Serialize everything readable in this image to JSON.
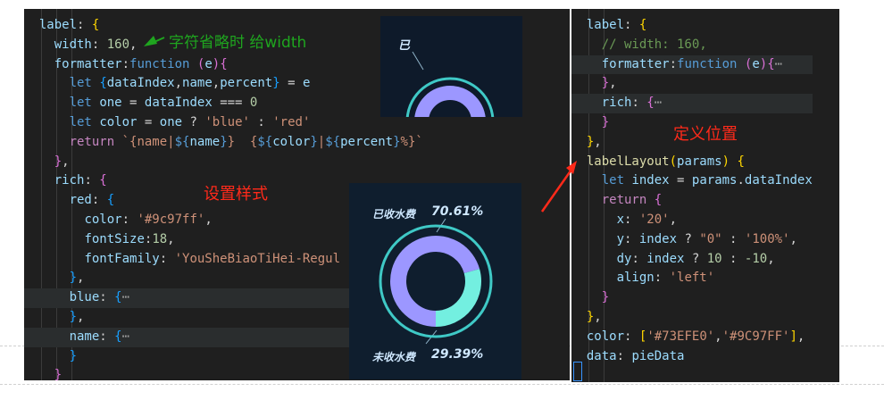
{
  "left_code": [
    {
      "hl": false,
      "t": [
        [
          "d",
          "  "
        ],
        [
          "v",
          "label"
        ],
        [
          "d",
          ": "
        ],
        [
          "y",
          "{"
        ]
      ]
    },
    {
      "hl": false,
      "t": [
        [
          "d",
          "    "
        ],
        [
          "v",
          "width"
        ],
        [
          "d",
          ": "
        ],
        [
          "n",
          "160"
        ],
        [
          "d",
          ","
        ]
      ]
    },
    {
      "hl": false,
      "t": [
        [
          "d",
          "    "
        ],
        [
          "v",
          "formatter"
        ],
        [
          "d",
          ":"
        ],
        [
          "k",
          "function"
        ],
        [
          "d",
          " "
        ],
        [
          "m",
          "("
        ],
        [
          "v",
          "e"
        ],
        [
          "m",
          ")"
        ],
        [
          "m",
          "{"
        ]
      ]
    },
    {
      "hl": false,
      "t": [
        [
          "d",
          "      "
        ],
        [
          "k",
          "let"
        ],
        [
          "d",
          " "
        ],
        [
          "b",
          "{"
        ],
        [
          "v",
          "dataIndex"
        ],
        [
          "d",
          ","
        ],
        [
          "v",
          "name"
        ],
        [
          "d",
          ","
        ],
        [
          "v",
          "percent"
        ],
        [
          "b",
          "}"
        ],
        [
          "d",
          " = "
        ],
        [
          "v",
          "e"
        ]
      ]
    },
    {
      "hl": false,
      "t": [
        [
          "d",
          "      "
        ],
        [
          "k",
          "let"
        ],
        [
          "d",
          " "
        ],
        [
          "v",
          "one"
        ],
        [
          "d",
          " = "
        ],
        [
          "v",
          "dataIndex"
        ],
        [
          "d",
          " === "
        ],
        [
          "n",
          "0"
        ]
      ]
    },
    {
      "hl": false,
      "t": [
        [
          "d",
          "      "
        ],
        [
          "k",
          "let"
        ],
        [
          "d",
          " "
        ],
        [
          "v",
          "color"
        ],
        [
          "d",
          " = "
        ],
        [
          "v",
          "one"
        ],
        [
          "d",
          " ? "
        ],
        [
          "s",
          "'blue'"
        ],
        [
          "d",
          " : "
        ],
        [
          "s",
          "'red'"
        ]
      ]
    },
    {
      "hl": false,
      "t": [
        [
          "d",
          "      "
        ],
        [
          "kw",
          "return"
        ],
        [
          "d",
          " "
        ],
        [
          "s",
          "`{name|"
        ],
        [
          "k",
          "${"
        ],
        [
          "v",
          "name"
        ],
        [
          "k",
          "}"
        ],
        [
          "s",
          "}  {"
        ],
        [
          "k",
          "${"
        ],
        [
          "v",
          "color"
        ],
        [
          "k",
          "}"
        ],
        [
          "s",
          "|"
        ],
        [
          "k",
          "${"
        ],
        [
          "v",
          "percent"
        ],
        [
          "k",
          "}"
        ],
        [
          "s",
          "%}`"
        ]
      ]
    },
    {
      "hl": false,
      "t": [
        [
          "d",
          "    "
        ],
        [
          "m",
          "}"
        ],
        [
          "d",
          ","
        ]
      ]
    },
    {
      "hl": false,
      "t": [
        [
          "d",
          "    "
        ],
        [
          "v",
          "rich"
        ],
        [
          "d",
          ": "
        ],
        [
          "m",
          "{"
        ]
      ]
    },
    {
      "hl": false,
      "t": [
        [
          "d",
          "      "
        ],
        [
          "v",
          "red"
        ],
        [
          "d",
          ": "
        ],
        [
          "b",
          "{"
        ]
      ]
    },
    {
      "hl": false,
      "t": [
        [
          "d",
          "        "
        ],
        [
          "v",
          "color"
        ],
        [
          "d",
          ": "
        ],
        [
          "s",
          "'#9c97ff'"
        ],
        [
          "d",
          ","
        ]
      ]
    },
    {
      "hl": false,
      "t": [
        [
          "d",
          "        "
        ],
        [
          "v",
          "fontSize"
        ],
        [
          "d",
          ":"
        ],
        [
          "n",
          "18"
        ],
        [
          "d",
          ","
        ]
      ]
    },
    {
      "hl": false,
      "t": [
        [
          "d",
          "        "
        ],
        [
          "v",
          "fontFamily"
        ],
        [
          "d",
          ": "
        ],
        [
          "s",
          "'YouSheBiaoTiHei-Regul"
        ]
      ]
    },
    {
      "hl": false,
      "t": [
        [
          "d",
          "      "
        ],
        [
          "b",
          "}"
        ],
        [
          "d",
          ","
        ]
      ]
    },
    {
      "hl": true,
      "t": [
        [
          "d",
          "      "
        ],
        [
          "v",
          "blue"
        ],
        [
          "d",
          ": "
        ],
        [
          "b",
          "{"
        ],
        [
          "fold",
          "⋯"
        ]
      ]
    },
    {
      "hl": false,
      "t": [
        [
          "d",
          "      "
        ],
        [
          "b",
          "}"
        ],
        [
          "d",
          ","
        ]
      ]
    },
    {
      "hl": true,
      "t": [
        [
          "d",
          "      "
        ],
        [
          "v",
          "name"
        ],
        [
          "d",
          ": "
        ],
        [
          "b",
          "{"
        ],
        [
          "fold",
          "⋯"
        ]
      ]
    },
    {
      "hl": false,
      "t": [
        [
          "d",
          "      "
        ],
        [
          "b",
          "}"
        ]
      ]
    },
    {
      "hl": false,
      "t": [
        [
          "d",
          "    "
        ],
        [
          "m",
          "}"
        ]
      ]
    }
  ],
  "right_code": [
    {
      "hl": false,
      "t": [
        [
          "d",
          "  "
        ],
        [
          "v",
          "label"
        ],
        [
          "d",
          ": "
        ],
        [
          "y",
          "{"
        ]
      ]
    },
    {
      "hl": false,
      "t": [
        [
          "d",
          "    "
        ],
        [
          "c",
          "// width: 160,"
        ]
      ]
    },
    {
      "hl": true,
      "t": [
        [
          "d",
          "    "
        ],
        [
          "v",
          "formatter"
        ],
        [
          "d",
          ":"
        ],
        [
          "k",
          "function"
        ],
        [
          "d",
          " "
        ],
        [
          "m",
          "("
        ],
        [
          "v",
          "e"
        ],
        [
          "m",
          ")"
        ],
        [
          "m",
          "{"
        ],
        [
          "fold",
          "⋯"
        ]
      ]
    },
    {
      "hl": false,
      "t": [
        [
          "d",
          "    "
        ],
        [
          "m",
          "}"
        ],
        [
          "d",
          ","
        ]
      ]
    },
    {
      "hl": true,
      "t": [
        [
          "d",
          "    "
        ],
        [
          "v",
          "rich"
        ],
        [
          "d",
          ": "
        ],
        [
          "m",
          "{"
        ],
        [
          "fold",
          "⋯"
        ]
      ]
    },
    {
      "hl": false,
      "t": [
        [
          "d",
          "    "
        ],
        [
          "m",
          "}"
        ]
      ]
    },
    {
      "hl": false,
      "t": [
        [
          "d",
          "  "
        ],
        [
          "y",
          "}"
        ],
        [
          "d",
          ","
        ]
      ]
    },
    {
      "hl": false,
      "t": [
        [
          "d",
          "  "
        ],
        [
          "f",
          "labelLayout"
        ],
        [
          "y",
          "("
        ],
        [
          "v",
          "params"
        ],
        [
          "y",
          ")"
        ],
        [
          "d",
          " "
        ],
        [
          "y",
          "{"
        ]
      ]
    },
    {
      "hl": false,
      "t": [
        [
          "d",
          "    "
        ],
        [
          "k",
          "let"
        ],
        [
          "d",
          " "
        ],
        [
          "v",
          "index"
        ],
        [
          "d",
          " = "
        ],
        [
          "v",
          "params"
        ],
        [
          "d",
          "."
        ],
        [
          "v",
          "dataIndex"
        ]
      ]
    },
    {
      "hl": false,
      "t": [
        [
          "d",
          "    "
        ],
        [
          "kw",
          "return"
        ],
        [
          "d",
          " "
        ],
        [
          "m",
          "{"
        ]
      ]
    },
    {
      "hl": false,
      "t": [
        [
          "d",
          "      "
        ],
        [
          "v",
          "x"
        ],
        [
          "d",
          ": "
        ],
        [
          "s",
          "'20'"
        ],
        [
          "d",
          ","
        ]
      ]
    },
    {
      "hl": false,
      "t": [
        [
          "d",
          "      "
        ],
        [
          "v",
          "y"
        ],
        [
          "d",
          ": "
        ],
        [
          "v",
          "index"
        ],
        [
          "d",
          " ? "
        ],
        [
          "s",
          "\"0\""
        ],
        [
          "d",
          " : "
        ],
        [
          "s",
          "'100%'"
        ],
        [
          "d",
          ","
        ]
      ]
    },
    {
      "hl": false,
      "t": [
        [
          "d",
          "      "
        ],
        [
          "v",
          "dy"
        ],
        [
          "d",
          ": "
        ],
        [
          "v",
          "index"
        ],
        [
          "d",
          " ? "
        ],
        [
          "n",
          "10"
        ],
        [
          "d",
          " : "
        ],
        [
          "n",
          "-10"
        ],
        [
          "d",
          ","
        ]
      ]
    },
    {
      "hl": false,
      "t": [
        [
          "d",
          "      "
        ],
        [
          "v",
          "align"
        ],
        [
          "d",
          ": "
        ],
        [
          "s",
          "'left'"
        ]
      ]
    },
    {
      "hl": false,
      "t": [
        [
          "d",
          "    "
        ],
        [
          "m",
          "}"
        ]
      ]
    },
    {
      "hl": false,
      "t": [
        [
          "d",
          "  "
        ],
        [
          "y",
          "}"
        ],
        [
          "d",
          ","
        ]
      ]
    },
    {
      "hl": false,
      "t": [
        [
          "d",
          "  "
        ],
        [
          "v",
          "color"
        ],
        [
          "d",
          ": "
        ],
        [
          "y",
          "["
        ],
        [
          "s",
          "'#73EFE0'"
        ],
        [
          "d",
          ","
        ],
        [
          "s",
          "'#9C97FF'"
        ],
        [
          "y",
          "]"
        ],
        [
          "d",
          ","
        ]
      ]
    },
    {
      "hl": false,
      "t": [
        [
          "d",
          "  "
        ],
        [
          "v",
          "data"
        ],
        [
          "d",
          ": "
        ],
        [
          "v",
          "pieData"
        ]
      ]
    }
  ],
  "annotations": {
    "ellipsis_note": "字符省略时  给width",
    "style_note": "设置样式",
    "position_note": "定义位置"
  },
  "preview_top": {
    "label": "已"
  },
  "preview_bottom": {
    "collected_label": "已收水费",
    "collected_pct": "70.61%",
    "uncollected_label": "未收水费",
    "uncollected_pct": "29.39%"
  },
  "pie": {
    "collected": 70.61,
    "uncollected": 29.39,
    "color_collected": "#9C97FF",
    "color_uncollected": "#73EFE0"
  },
  "colors": {
    "annotation_green": "#1fa51f",
    "annotation_red": "#ff2a1a",
    "editor_bg": "#1f1f1f"
  }
}
